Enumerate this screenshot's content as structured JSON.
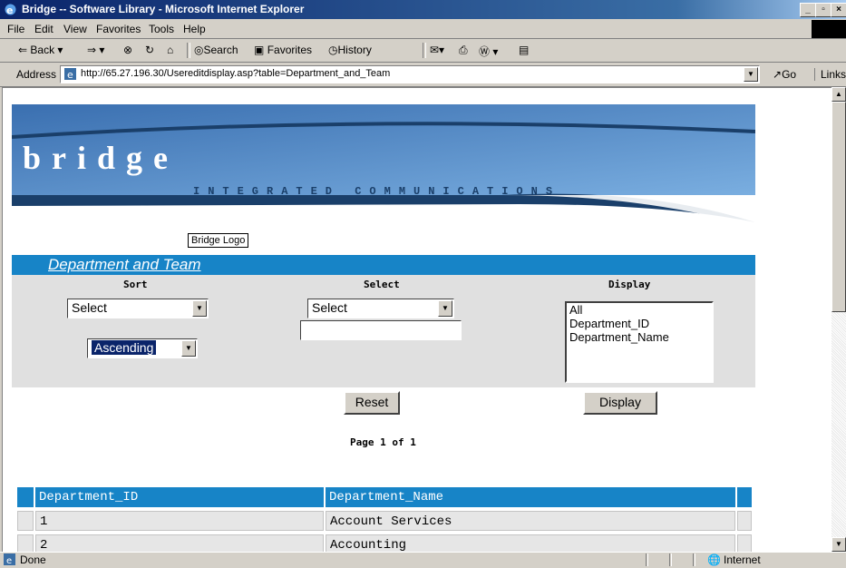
{
  "window": {
    "title": "Bridge -- Software Library - Microsoft Internet Explorer"
  },
  "menu": [
    "File",
    "Edit",
    "View",
    "Favorites",
    "Tools",
    "Help"
  ],
  "toolbar": {
    "back": "Back",
    "search": "Search",
    "favorites": "Favorites",
    "history": "History"
  },
  "address": {
    "label": "Address",
    "url": "http://65.27.196.30/Usereditdisplay.asp?table=Department_and_Team",
    "go": "Go",
    "links": "Links"
  },
  "banner": {
    "brand": "bridge",
    "tagline": "INTEGRATED COMMUNICATIONS",
    "logo_alt": "Bridge Logo"
  },
  "section": {
    "title": "Department and Team"
  },
  "filters": {
    "sort": {
      "label": "Sort",
      "value": "Select",
      "order": "Ascending"
    },
    "select": {
      "label": "Select",
      "value": "Select",
      "text": ""
    },
    "display": {
      "label": "Display",
      "options": [
        "All",
        "Department_ID",
        "Department_Name"
      ]
    }
  },
  "buttons": {
    "reset": "Reset",
    "display": "Display"
  },
  "pagination": {
    "text": "Page 1 of 1"
  },
  "table": {
    "columns": [
      "Department_ID",
      "Department_Name"
    ],
    "rows": [
      [
        "1",
        "Account Services"
      ],
      [
        "2",
        "Accounting"
      ]
    ]
  },
  "status": {
    "text": "Done",
    "zone": "Internet"
  },
  "colors": {
    "accent": "#1784c7",
    "banner": "#4f86c6",
    "titlebar": "#0a246a"
  }
}
